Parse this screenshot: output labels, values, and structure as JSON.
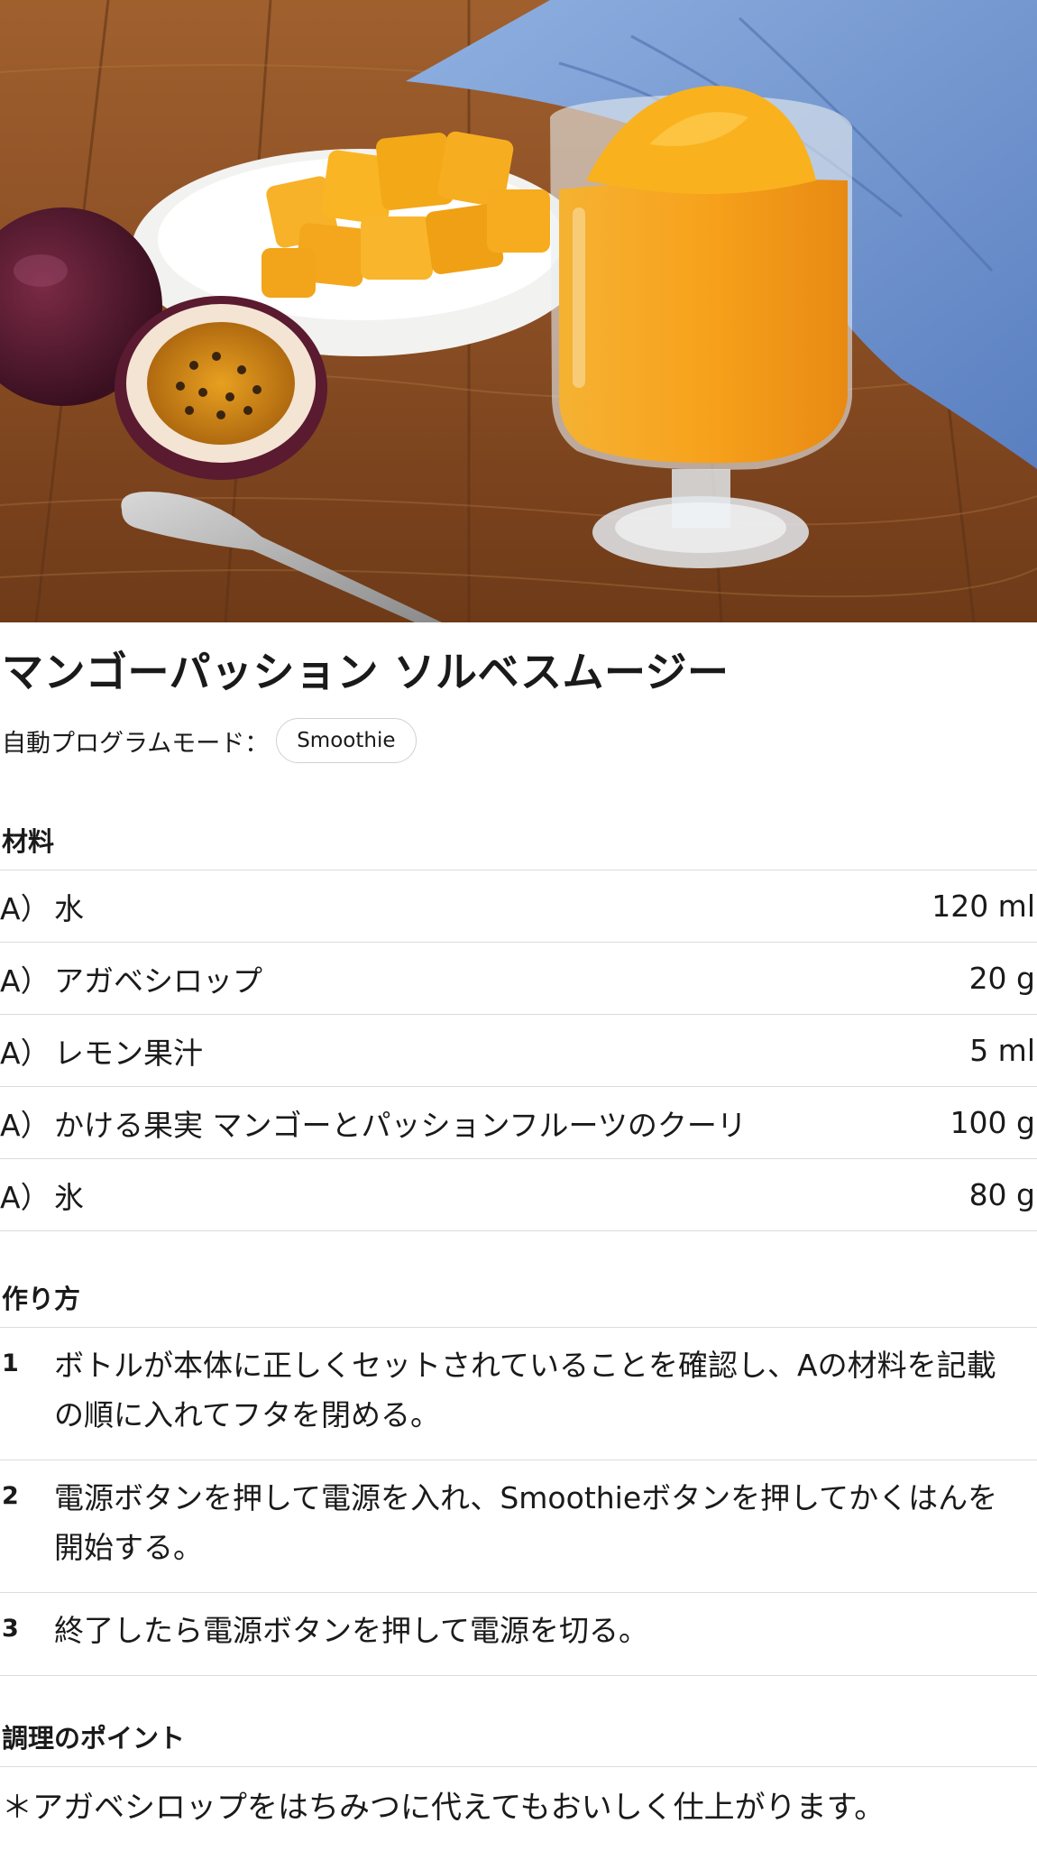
{
  "hero": {
    "image_alt": "mango passion sorbet smoothie photo"
  },
  "recipe": {
    "title": "マンゴーパッション ソルベスムージー",
    "mode_label": "自動プログラムモード：",
    "mode_value": "Smoothie"
  },
  "ingredients": {
    "heading": "材料",
    "items": [
      {
        "group": "A）",
        "name": "水",
        "amount": "120 ml"
      },
      {
        "group": "A）",
        "name": "アガベシロップ",
        "amount": "20 g"
      },
      {
        "group": "A）",
        "name": "レモン果汁",
        "amount": "5 ml"
      },
      {
        "group": "A）",
        "name": "かける果実 マンゴーとパッションフルーツのクーリ",
        "amount": "100 g"
      },
      {
        "group": "A）",
        "name": "氷",
        "amount": "80 g"
      }
    ]
  },
  "method": {
    "heading": "作り方",
    "steps": [
      {
        "num": "1",
        "text": "ボトルが本体に正しくセットされていることを確認し、Aの材料を記載の順に入れてフタを閉める。"
      },
      {
        "num": "2",
        "text": "電源ボタンを押して電源を入れ、Smoothieボタンを押してかくはんを開始する。"
      },
      {
        "num": "3",
        "text": "終了したら電源ボタンを押して電源を切る。"
      }
    ]
  },
  "tips": {
    "heading": "調理のポイント",
    "text": "＊アガベシロップをはちみつに代えてもおいしく仕上がります。"
  },
  "colors": {
    "wood": "#8a4e24",
    "wood_dark": "#5c3116",
    "cloth": "#6f94cf",
    "mango": "#f4a321",
    "smoothie": "#f09a1c",
    "passion_skin": "#4a1a2a"
  }
}
